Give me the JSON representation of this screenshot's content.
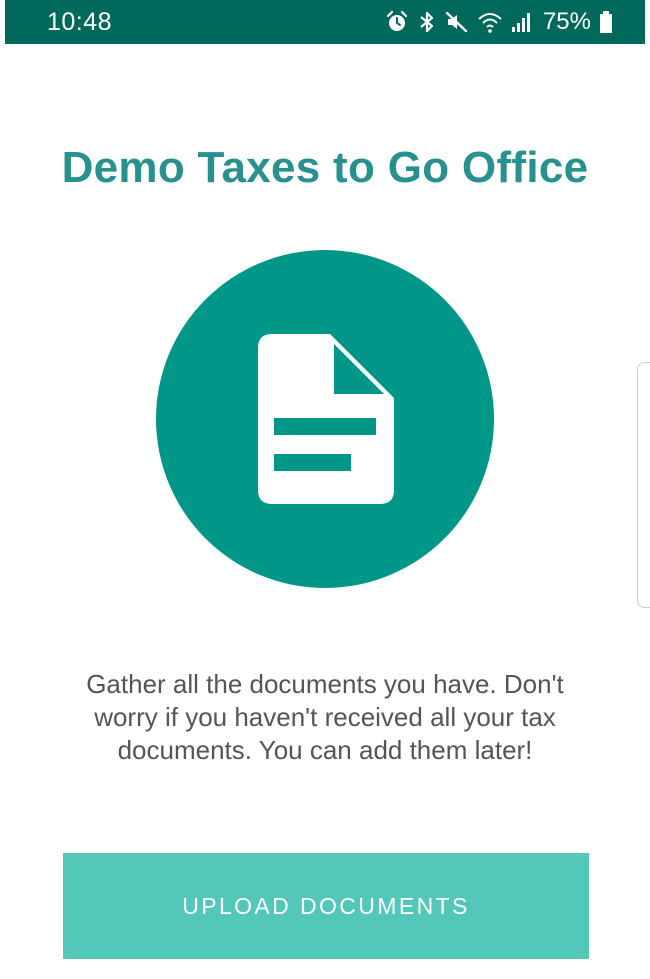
{
  "status_bar": {
    "time": "10:48",
    "battery": "75%",
    "icons": [
      "alarm-icon",
      "bluetooth-icon",
      "mute-icon",
      "wifi-icon",
      "signal-icon",
      "battery-icon"
    ],
    "background": "#00695c"
  },
  "page": {
    "title": "Demo Taxes to Go Office",
    "title_color": "#26918f",
    "hero_icon": "document-icon",
    "hero_color": "#009688",
    "description": "Gather all the documents you have. Don't worry if you haven't received all your tax documents. You can add them later!",
    "button_label": "UPLOAD DOCUMENTS",
    "button_color": "#54c8b8"
  }
}
